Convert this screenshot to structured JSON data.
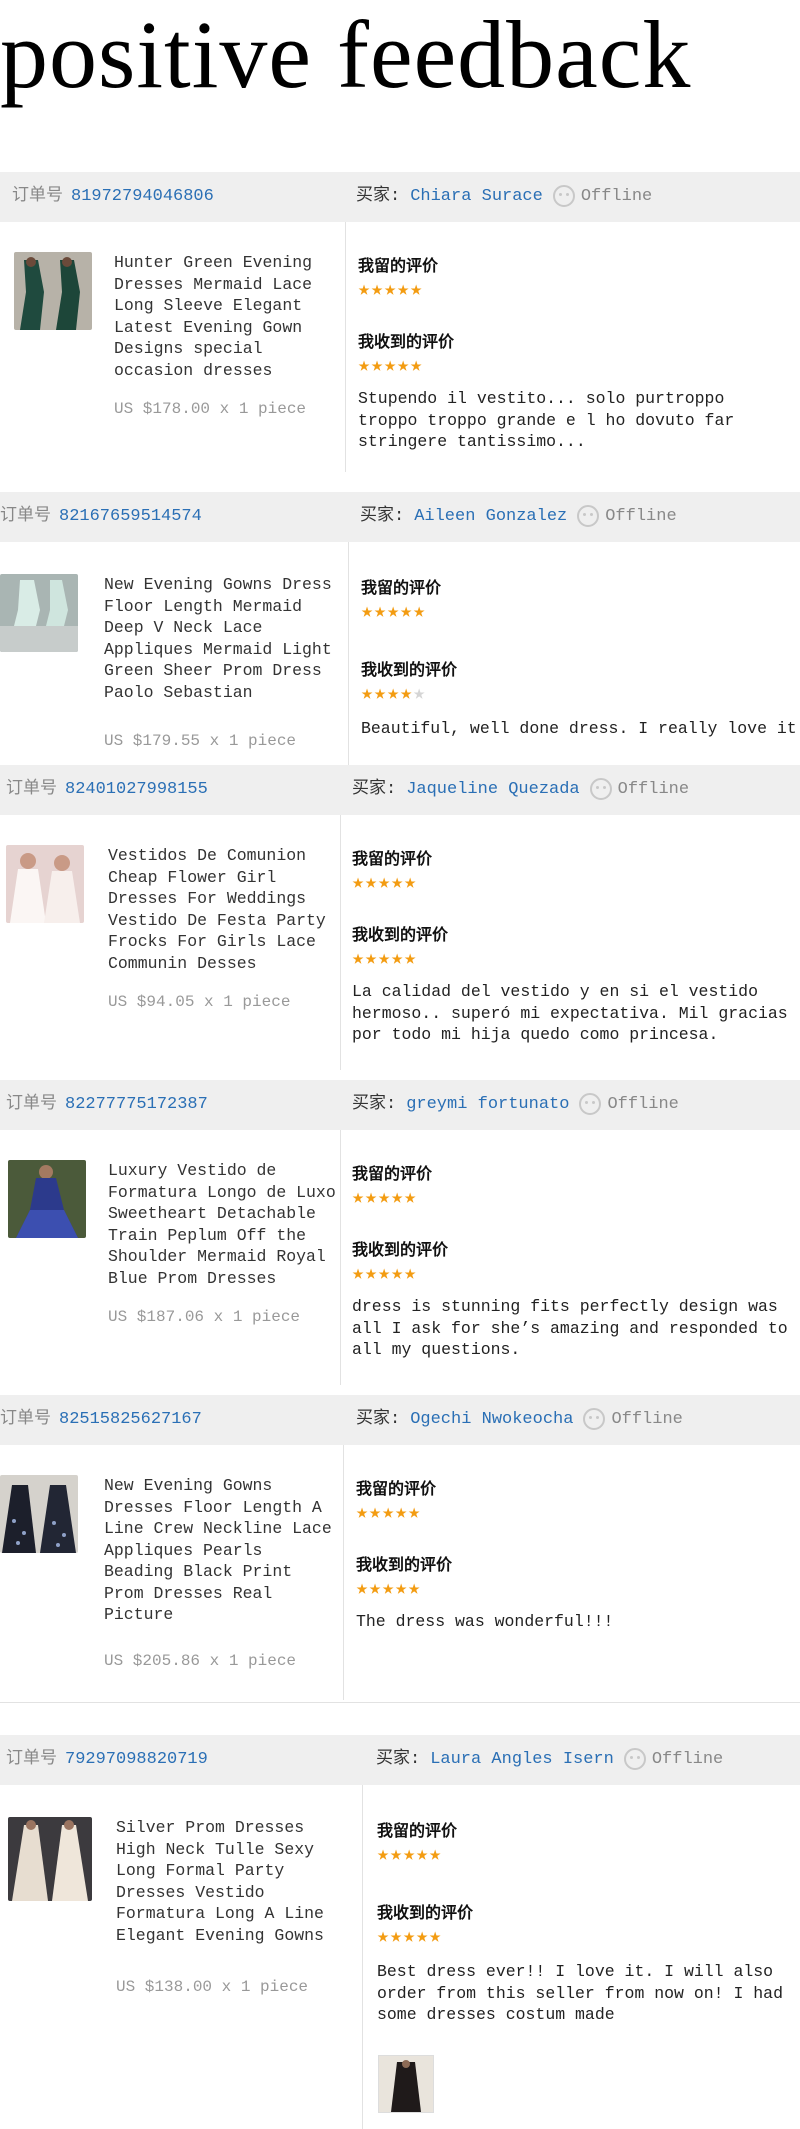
{
  "headline": "positive feedback",
  "labels": {
    "order_no": "订单号",
    "buyer": "买家:",
    "my_rating": "我留的评价",
    "received_rating": "我收到的评价"
  },
  "accent_color": "#2a6fb5",
  "star_color": "#f39c12",
  "orders": [
    {
      "order_no": "81972794046806",
      "buyer_name": "Chiara Surace",
      "status": "Offline",
      "product_name": "Hunter Green Evening Dresses Mermaid Lace Long Sleeve Elegant Latest Evening Gown Designs special occasion dresses",
      "price": "US $178.00 x 1 piece",
      "my_stars": 5,
      "received_stars": 5,
      "stars_my": "★★★★★",
      "stars_received": "★★★★★",
      "review": "Stupendo il vestito... solo purtroppo troppo troppo grande e l ho dovuto far stringere tantissimo..."
    },
    {
      "order_no": "82167659514574",
      "buyer_name": "Aileen Gonzalez",
      "status": "Offline",
      "product_name": "New Evening Gowns Dress Floor Length Mermaid Deep V Neck Lace Appliques Mermaid Light Green Sheer Prom Dress Paolo Sebastian",
      "price": "US $179.55 x 1 piece",
      "my_stars": 5,
      "received_stars": 4,
      "stars_my": "★★★★★",
      "stars_received": "★★★★",
      "stars_received_off": "★",
      "review": "Beautiful, well done dress. I really love it!"
    },
    {
      "order_no": "82401027998155",
      "buyer_name": "Jaqueline Quezada",
      "status": "Offline",
      "product_name": "Vestidos De Comunion Cheap Flower Girl Dresses For Weddings Vestido De Festa Party Frocks For Girls Lace Communin Desses",
      "price": "US $94.05 x 1 piece",
      "my_stars": 5,
      "received_stars": 5,
      "stars_my": "★★★★★",
      "stars_received": "★★★★★",
      "review": "La calidad del vestido y en si el vestido hermoso.. superó mi expectativa. Mil gracias por todo mi hija quedo como princesa."
    },
    {
      "order_no": "82277775172387",
      "buyer_name": "greymi fortunato",
      "status": "Offline",
      "product_name": "Luxury Vestido de Formatura Longo de Luxo Sweetheart Detachable Train Peplum Off the Shoulder Mermaid Royal Blue Prom Dresses",
      "price": "US $187.06 x 1 piece",
      "my_stars": 5,
      "received_stars": 5,
      "stars_my": "★★★★★",
      "stars_received": "★★★★★",
      "review": "dress is stunning fits perfectly design was all I ask for she’s amazing and responded to all my questions."
    },
    {
      "order_no": "82515825627167",
      "buyer_name": "Ogechi Nwokeocha",
      "status": "Offline",
      "product_name": "New Evening Gowns Dresses Floor Length A Line Crew Neckline Lace Appliques Pearls Beading Black Print Prom Dresses Real Picture",
      "price": "US $205.86 x 1 piece",
      "my_stars": 5,
      "received_stars": 5,
      "stars_my": "★★★★★",
      "stars_received": "★★★★★",
      "review": "The dress was wonderful!!!"
    },
    {
      "order_no": "79297098820719",
      "buyer_name": "Laura Angles Isern",
      "status": "Offline",
      "product_name": "Silver Prom Dresses High Neck Tulle Sexy Long Formal Party Dresses Vestido Formatura Long A Line Elegant Evening Gowns",
      "price": "US $138.00 x 1 piece",
      "my_stars": 5,
      "received_stars": 5,
      "stars_my": "★★★★★",
      "stars_received": "★★★★★",
      "review": "Best dress ever!! I love it. I will also order from this seller from now on! I had some dresses costum made"
    }
  ]
}
